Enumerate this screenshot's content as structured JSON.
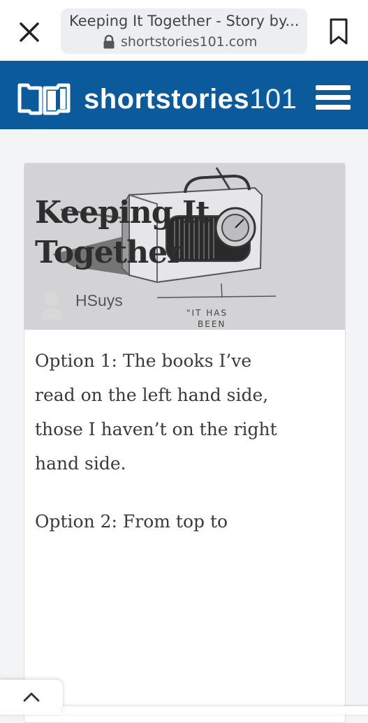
{
  "browser": {
    "page_title": "Keeping It Together - Story by...",
    "url": "shortstories101.com",
    "close_icon": "close-icon",
    "lock_icon": "lock-icon",
    "bookmark_icon": "bookmark-icon"
  },
  "site": {
    "brand_name": "shortstories",
    "brand_number": "101",
    "brand_color": "#0a5a9c",
    "logo_icon": "open-book-icon",
    "menu_icon": "hamburger-menu-icon"
  },
  "story": {
    "illustration_caption_line1": "\"IT HAS",
    "illustration_caption_line2": "BEEN",
    "title": "Keeping It Together",
    "author": "HSuys",
    "paragraphs": [
      "Option 1: The books I’ve read on the left hand side, those I haven’t on the right hand side.",
      "Option 2: From top to"
    ]
  },
  "controls": {
    "scroll_top_icon": "chevron-up-icon"
  }
}
